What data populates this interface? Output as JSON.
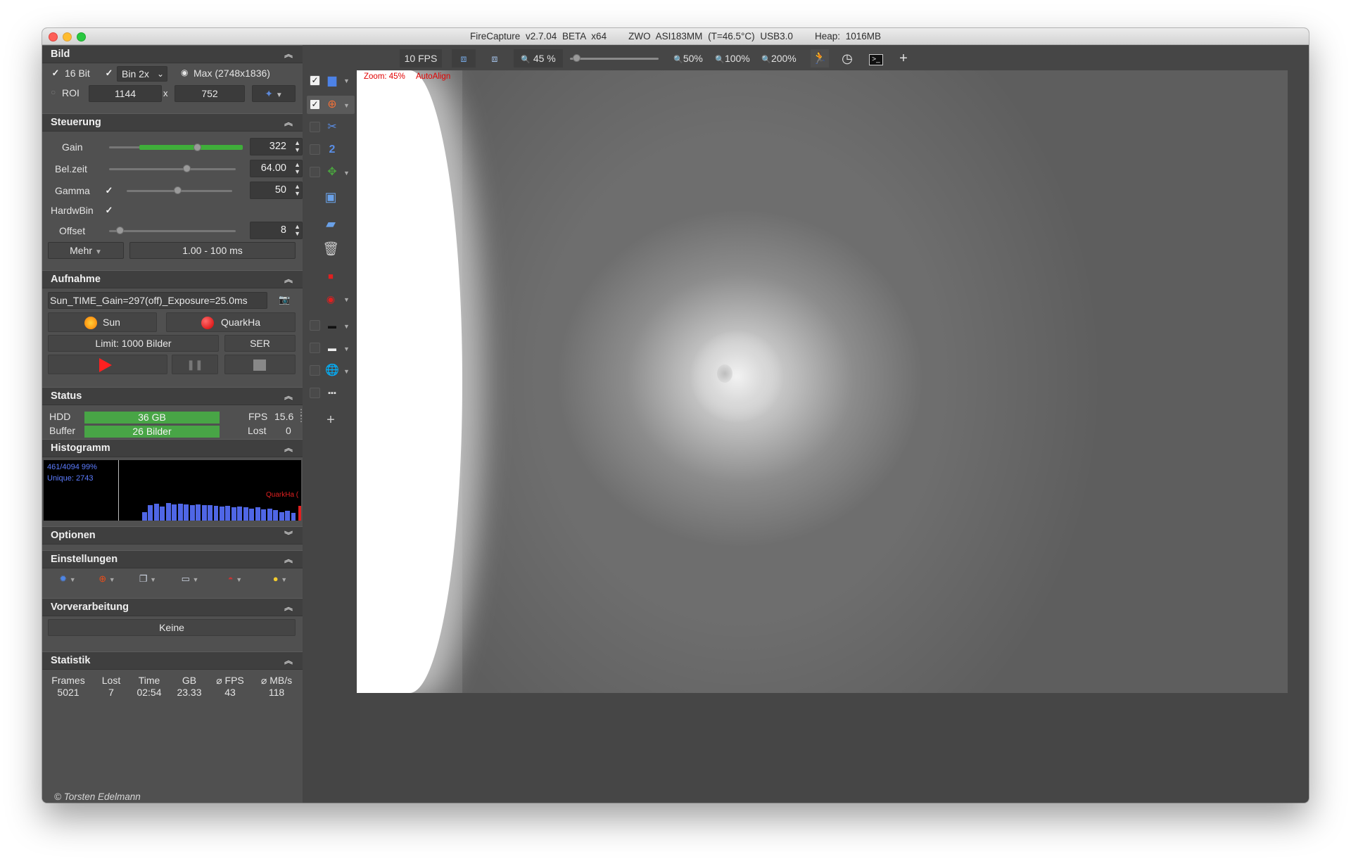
{
  "window": {
    "title": "FireCapture v2.7.04 BETA x64",
    "camera": "ZWO ASI183MM (T=46.5°C) USB3.0",
    "heap": "Heap: 1016MB"
  },
  "bild": {
    "title": "Bild",
    "bit_label": "16 Bit",
    "bin_value": "Bin 2x",
    "max_label": "Max (2748x1836)",
    "roi_label": "ROI",
    "roi_w": "1144",
    "roi_x": "x",
    "roi_h": "752"
  },
  "steuerung": {
    "title": "Steuerung",
    "gain": {
      "label": "Gain",
      "value": "322",
      "level": 0.7
    },
    "belzeit": {
      "label": "Bel.zeit",
      "value": "64.00",
      "level": 0.62
    },
    "gamma": {
      "label": "Gamma",
      "value": "50",
      "level": 0.48
    },
    "hardwbin": {
      "label": "HardwBin"
    },
    "offset": {
      "label": "Offset",
      "value": "8",
      "level": 0.08
    },
    "mehr": "Mehr",
    "range": "1.00 - 100 ms"
  },
  "aufnahme": {
    "title": "Aufnahme",
    "filename": "Sun_TIME_Gain=297(off)_Exposure=25.0ms",
    "profile1": "Sun",
    "profile2": "QuarkHa",
    "limit": "Limit: 1000 Bilder",
    "format": "SER"
  },
  "status": {
    "title": "Status",
    "hdd_label": "HDD",
    "hdd_value": "36 GB",
    "fps_label": "FPS",
    "fps_value": "15.6",
    "buffer_label": "Buffer",
    "buffer_value": "26  Bilder",
    "lost_label": "Lost",
    "lost_value": "0"
  },
  "histogramm": {
    "title": "Histogramm",
    "line1": "461/4094 99%",
    "line2": "Unique: 2743",
    "profile_tag": "QuarkHa (",
    "bars": [
      0.3,
      0.55,
      0.6,
      0.5,
      0.62,
      0.58,
      0.6,
      0.57,
      0.56,
      0.58,
      0.54,
      0.55,
      0.52,
      0.5,
      0.53,
      0.48,
      0.5,
      0.47,
      0.42,
      0.48,
      0.4,
      0.42,
      0.38,
      0.3,
      0.35,
      0.28
    ]
  },
  "optionen": {
    "title": "Optionen"
  },
  "einstellungen": {
    "title": "Einstellungen"
  },
  "vorverarbeitung": {
    "title": "Vorverarbeitung",
    "value": "Keine"
  },
  "statistik": {
    "title": "Statistik",
    "cols": [
      {
        "h": "Frames",
        "v": "5021"
      },
      {
        "h": "Lost",
        "v": "7"
      },
      {
        "h": "Time",
        "v": "02:54"
      },
      {
        "h": "GB",
        "v": "23.33"
      },
      {
        "h": "⌀ FPS",
        "v": "43"
      },
      {
        "h": "⌀ MB/s",
        "v": "118"
      }
    ]
  },
  "copyright": "© Torsten Edelmann",
  "toolbar": {
    "fps": "10 FPS",
    "zoom": "45 %",
    "zoom_level": 0.05,
    "z50": "50%",
    "z100": "100%",
    "z200": "200%",
    "plus": "+"
  },
  "image": {
    "zoom_overlay": "Zoom: 45%",
    "autoalign": "AutoAlign"
  }
}
